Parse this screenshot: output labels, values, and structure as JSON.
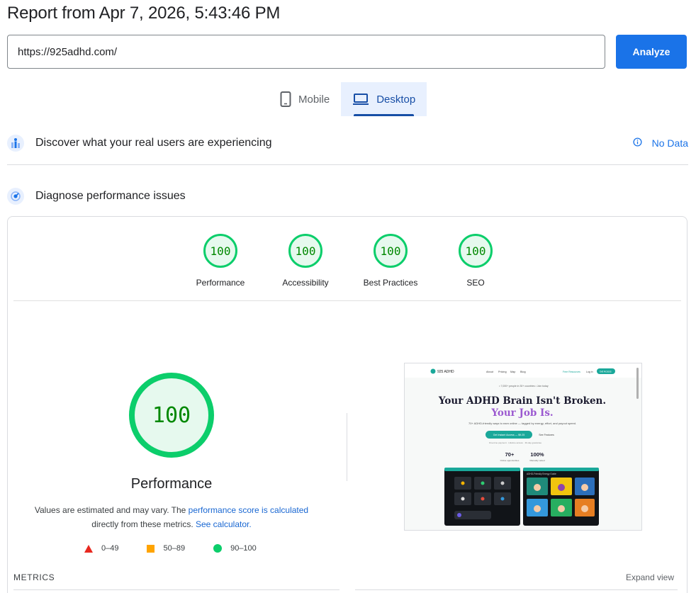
{
  "header": {
    "title": "Report from Apr 7, 2026, 5:43:46 PM"
  },
  "search": {
    "value": "https://925adhd.com/",
    "analyze_label": "Analyze"
  },
  "device_tabs": [
    {
      "label": "Mobile",
      "active": false
    },
    {
      "label": "Desktop",
      "active": true
    }
  ],
  "field_data": {
    "title": "Discover what your real users are experiencing",
    "status": "No Data"
  },
  "diagnose": {
    "title": "Diagnose performance issues"
  },
  "scores": [
    {
      "label": "Performance",
      "value": "100"
    },
    {
      "label": "Accessibility",
      "value": "100"
    },
    {
      "label": "Best Practices",
      "value": "100"
    },
    {
      "label": "SEO",
      "value": "100"
    }
  ],
  "performance": {
    "score": "100",
    "title": "Performance",
    "note_before": "Values are estimated and may vary. The ",
    "note_link1": "performance score is calculated",
    "note_middle": " directly from these metrics. ",
    "note_link2": "See calculator."
  },
  "legend": [
    {
      "label": "0–49"
    },
    {
      "label": "50–89"
    },
    {
      "label": "90–100"
    }
  ],
  "thumbnail": {
    "logo": "925 ADHD",
    "nav": [
      "About",
      "Pricing",
      "Map",
      "Blog"
    ],
    "nav_cta1": "Free Resources",
    "nav_cta2": "Log in",
    "nav_cta3": "Get Access",
    "tagline": "• 7,000+ people in 30+ countries • Join today",
    "headline1": "Your ADHD Brain Isn't Broken.",
    "headline2": "Your Job Is.",
    "sub": "70+ ADHD-friendly ways to earn online — tagged by energy, effort, and payout speed.",
    "cta_primary": "Get Instant Access — $9.25",
    "cta_secondary": "See Features",
    "fine_print": "One-time payment · Lifetime access · 30-day guarantee",
    "stat1_value": "70+",
    "stat1_label": "Online opportunities",
    "stat2_value": "100%",
    "stat2_label": "Manually vetted",
    "panel2_title": "ADHD-Friendly Energy Guide"
  },
  "metrics": {
    "label": "METRICS",
    "expand": "Expand view"
  }
}
